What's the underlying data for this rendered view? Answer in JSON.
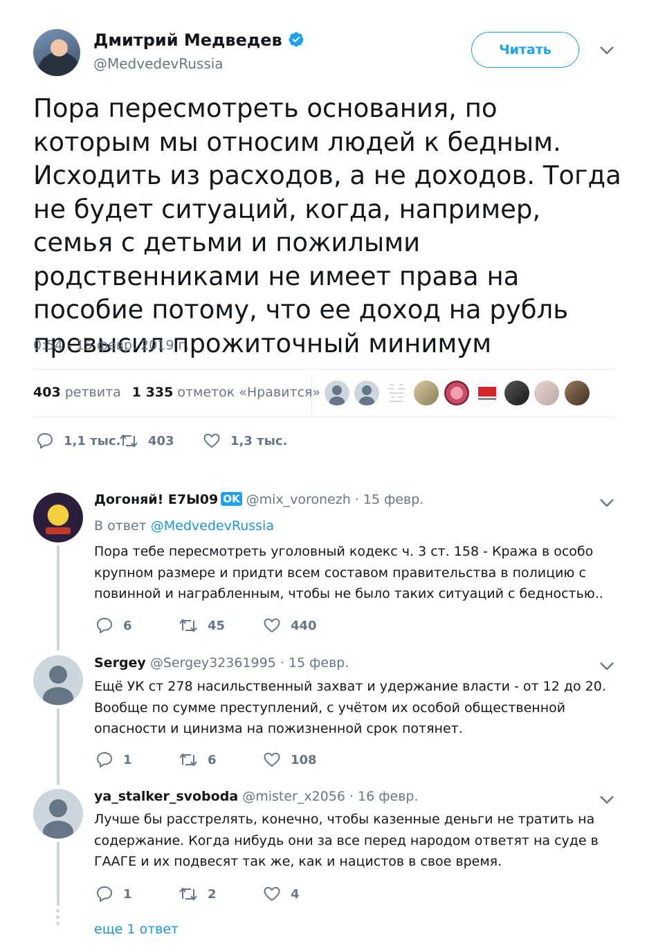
{
  "tweet": {
    "author_name": "Дмитрий Медведев",
    "author_handle": "@MedvedevRussia",
    "follow_label": "Читать",
    "text": "Пора пересмотреть основания, по которым мы относим людей к бедным. Исходить из расходов, а не доходов. Тогда не будет ситуаций, когда, например, семья с детьми и пожилыми родственниками не имеет права на пособие потому, что ее доход на рубль превысил прожиточный минимум",
    "timestamp": "0:54 - 15 февр. 2019 г.",
    "retweets_count": "403",
    "retweets_label": "ретвита",
    "likes_count": "1 335",
    "likes_label": "отметок «Нравится»",
    "actions": {
      "replies": "1,1 тыс.",
      "retweets": "403",
      "likes": "1,3 тыс."
    }
  },
  "replies": [
    {
      "name": "Догоняй! Е7Ы09",
      "badge": "OK",
      "handle": "@mix_voronezh",
      "date": "· 15 февр.",
      "in_reply_prefix": "В ответ",
      "in_reply_to": "@MedvedevRussia",
      "text": "Пора тебе пересмотреть уголовный кодекс ч. 3 ст. 158 - Кража в особо крупном размере и придти всем составом правительства в полицию с повинной и награбленным, чтобы не было таких ситуаций с бедностью..",
      "replies": "6",
      "retweets": "45",
      "likes": "440"
    },
    {
      "name": "Sergey",
      "handle": "@Sergey32361995",
      "date": "· 15 февр.",
      "text": "Ещё УК ст 278 насильственный захват и удержание власти - от 12 до 20. Вообще по сумме преступлений, с учётом их особой общественной опасности и цинизма на пожизненной срок потянет.",
      "replies": "1",
      "retweets": "6",
      "likes": "108"
    },
    {
      "name": "ya_stalker_svoboda",
      "handle": "@mister_x2056",
      "date": "· 16 февр.",
      "text": "Лучше бы расстрелять, конечно, чтобы казенные деньги не тратить на содержание. Когда нибудь они за все перед народом ответят на суде в ГААГЕ и их подвесят так же, как и нацистов в свое время.",
      "replies": "1",
      "retweets": "2",
      "likes": "4"
    }
  ],
  "more_replies_label": "еще 1 ответ",
  "colors": {
    "accent": "#1da1f2",
    "link": "#1b95e0",
    "muted": "#657786",
    "text": "#14171a",
    "divider": "#e6ecf0",
    "thread_line": "#ccd6dd"
  }
}
